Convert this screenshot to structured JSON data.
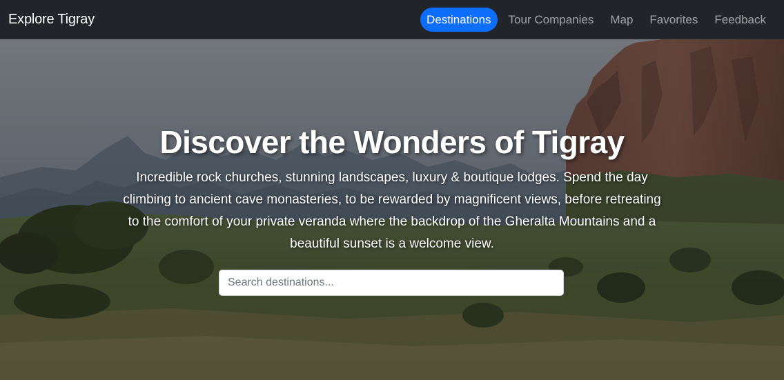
{
  "navbar": {
    "brand": "Explore Tigray",
    "links": [
      {
        "label": "Destinations",
        "active": true
      },
      {
        "label": "Tour Companies",
        "active": false
      },
      {
        "label": "Map",
        "active": false
      },
      {
        "label": "Favorites",
        "active": false
      },
      {
        "label": "Feedback",
        "active": false
      }
    ]
  },
  "hero": {
    "title": "Discover the Wonders of Tigray",
    "description": "Incredible rock churches, stunning landscapes, luxury & boutique lodges. Spend the day climbing to ancient cave monasteries, to be rewarded by magnificent views, before retreating to the comfort of your private veranda where the backdrop of the Gheralta Mountains and a beautiful sunset is a welcome view.",
    "search": {
      "value": "",
      "placeholder": "Search destinations..."
    }
  },
  "colors": {
    "navbar_bg": "#212529",
    "accent": "#0d6efd",
    "nav_inactive": "rgba(255,255,255,0.55)"
  }
}
